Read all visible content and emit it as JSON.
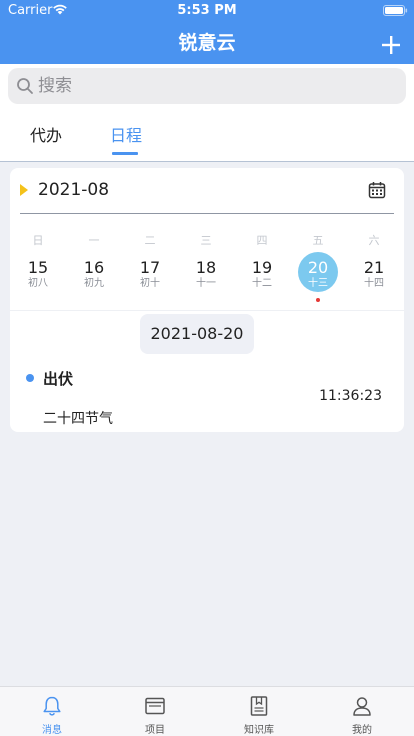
{
  "status_bar": {
    "carrier": "Carrier",
    "time": "5:53 PM"
  },
  "nav": {
    "title": "锐意云",
    "add_icon": "plus-icon"
  },
  "search": {
    "placeholder": "搜索",
    "value": ""
  },
  "tabs": [
    {
      "label": "代办",
      "active": false
    },
    {
      "label": "日程",
      "active": true
    }
  ],
  "calendar": {
    "month": "2021-08",
    "weekdays": [
      "日",
      "一",
      "二",
      "三",
      "四",
      "五",
      "六"
    ],
    "days": [
      {
        "num": "15",
        "lunar": "初八"
      },
      {
        "num": "16",
        "lunar": "初九"
      },
      {
        "num": "17",
        "lunar": "初十"
      },
      {
        "num": "18",
        "lunar": "十一"
      },
      {
        "num": "19",
        "lunar": "十二"
      },
      {
        "num": "20",
        "lunar": "十三"
      },
      {
        "num": "21",
        "lunar": "十四"
      }
    ],
    "selected_date": "2021-08-20"
  },
  "event": {
    "name": "出伏",
    "time": "11:36:23",
    "description": "二十四节气"
  },
  "tabbar": [
    {
      "label": "消息",
      "icon": "bell-icon",
      "active": true
    },
    {
      "label": "项目",
      "icon": "folder-icon",
      "active": false
    },
    {
      "label": "知识库",
      "icon": "book-icon",
      "active": false
    },
    {
      "label": "我的",
      "icon": "person-icon",
      "active": false
    }
  ],
  "colors": {
    "primary": "#4a93f0",
    "selected_day": "#7cc9ef",
    "month_marker": "#f4c21b",
    "event_dot": "#4a93f0"
  }
}
